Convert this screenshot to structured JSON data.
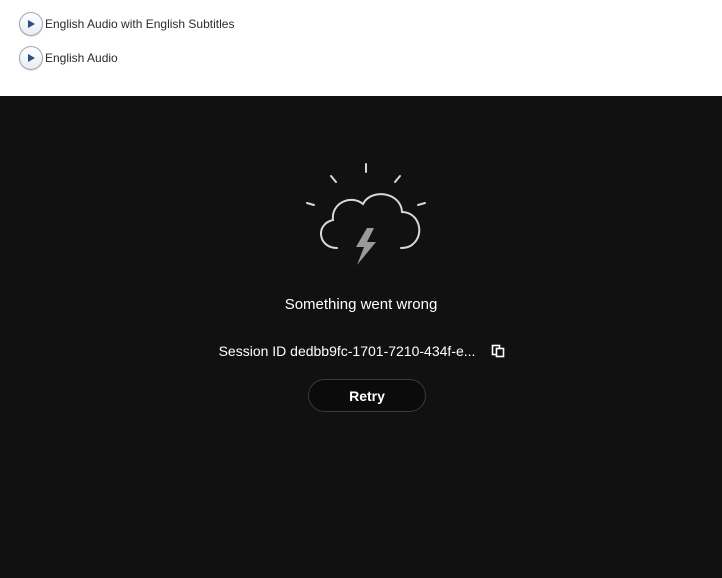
{
  "audio_options": [
    {
      "label": "English Audio with English Subtitles",
      "icon": "play-icon"
    },
    {
      "label": "English Audio",
      "icon": "play-icon"
    }
  ],
  "player": {
    "background": "#111111",
    "error_icon": "storm-cloud-icon",
    "error_message": "Something went wrong",
    "session_id_text": "Session ID dedbb9fc-1701-7210-434f-e...",
    "copy_icon": "copy-icon",
    "retry_label": "Retry"
  }
}
